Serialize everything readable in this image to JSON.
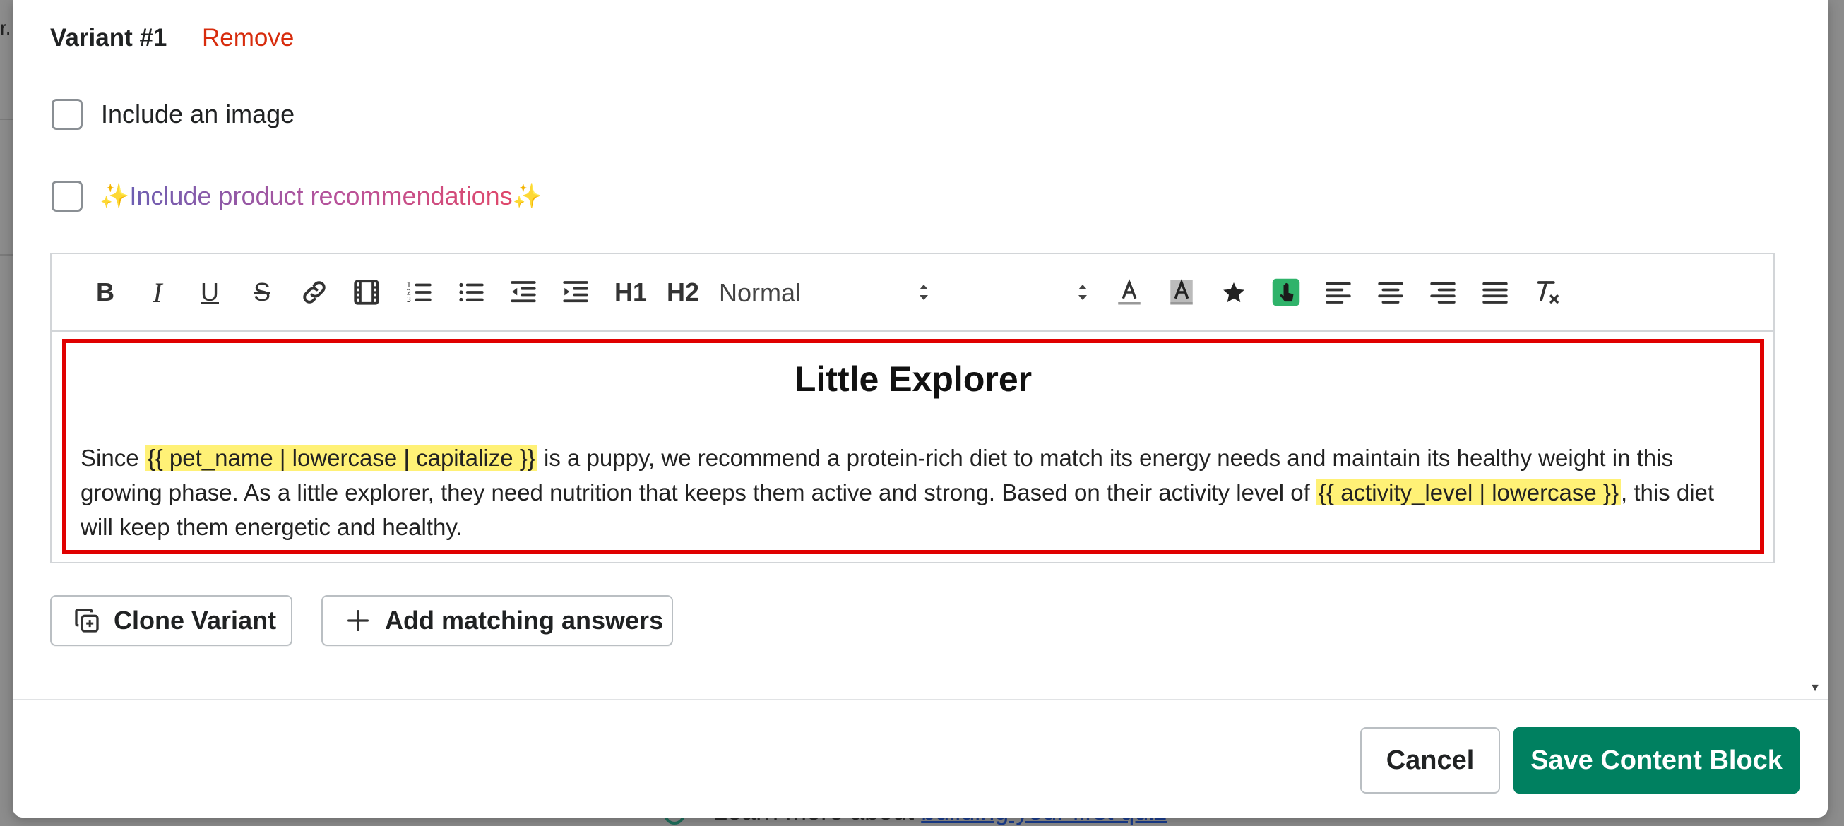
{
  "background": {
    "fragment": "r.",
    "learn_more_prefix": "Learn more about",
    "learn_more_link": "building your first quiz"
  },
  "variant": {
    "title": "Variant #1",
    "remove_label": "Remove",
    "include_image_label": "Include an image",
    "include_image_checked": false,
    "include_recs_label": "Include product recommendations",
    "include_recs_checked": false,
    "sparkle": "✨"
  },
  "toolbar": {
    "bold": "B",
    "italic": "I",
    "underline": "U",
    "strike": "S",
    "h1": "H1",
    "h2": "H2",
    "format_value": "Normal",
    "font_size_value": ""
  },
  "editor": {
    "heading": "Little Explorer",
    "text_1": "Since ",
    "var_1": "{{ pet_name | lowercase | capitalize }}",
    "text_2": " is a puppy, we recommend a protein-rich diet to match its energy needs and maintain its healthy weight in this growing phase. As a little explorer, they need nutrition that keeps them active and strong. Based on their activity level of ",
    "var_2": "{{ activity_level | lowercase }}",
    "text_3": ", this diet will keep them energetic and healthy.",
    "highlight_color": "#fff176",
    "border_color": "#e00000"
  },
  "actions": {
    "clone_label": "Clone Variant",
    "add_answers_label": "Add matching answers"
  },
  "footer": {
    "cancel_label": "Cancel",
    "save_label": "Save Content Block",
    "save_color": "#008060"
  }
}
